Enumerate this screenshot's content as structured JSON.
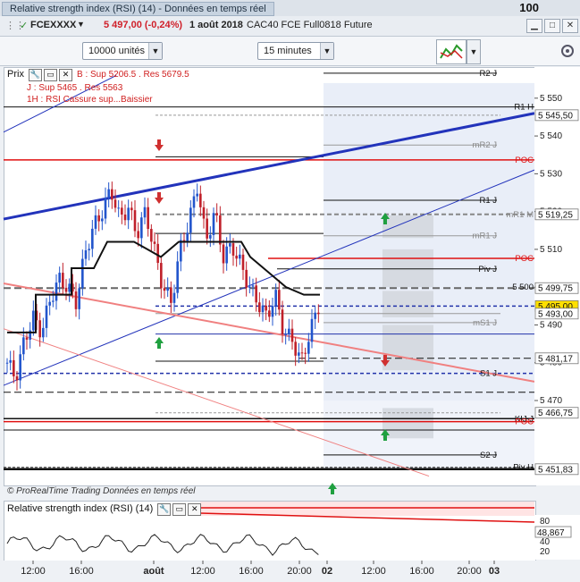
{
  "top_strip": {
    "tab": "Relative strength index (RSI) (14) - Données en temps réel",
    "value": "100"
  },
  "title": {
    "instrument": "FCEXXXX",
    "price_change": "5 497,00 (-0,24%)",
    "date": "1 août 2018",
    "description": "CAC40 FCE Full0818 Future"
  },
  "toolbar": {
    "quantity": "10000 unités",
    "timeframe": "15 minutes"
  },
  "price_panel": {
    "name": "Prix",
    "annotations": [
      "B : Sup 5206.5 . Res 5679.5",
      "J : Sup 5465 . Res 5563",
      "1H : RSI Cassure sup...Baissier"
    ],
    "footer": "© ProRealTime Trading  Données en temps réel"
  },
  "rsi_panel": {
    "name": "Relative strength index (RSI) (14)",
    "value": "48,867"
  },
  "x_axis": [
    "12:00",
    "16:00",
    "août",
    "12:00",
    "16:00",
    "20:00",
    "02",
    "12:00",
    "16:00",
    "20:00",
    "03"
  ],
  "colors": {
    "up": "#2255cc",
    "down": "#c0202a",
    "blue_trend": "#2233bb",
    "poc": "#e01010",
    "pink_trend": "#f08080"
  },
  "chart_data": {
    "type": "candlestick",
    "title": "FCEXXXX 15 minutes",
    "ylim": [
      5448,
      5558
    ],
    "y_ticks": [
      5470,
      5480,
      5490,
      5500,
      5510,
      5520,
      5530,
      5540,
      5550
    ],
    "price_labels": [
      {
        "label": "R2 J",
        "value": 5556.6
      },
      {
        "label": "R1 H",
        "value": 5547.67
      },
      {
        "label": "",
        "value": 5545.5
      },
      {
        "label": "mR2 J",
        "value": 5537.6
      },
      {
        "label": "POC",
        "value": 5533.67
      },
      {
        "label": "R1 J",
        "value": 5523.0
      },
      {
        "label": "mR1 M",
        "value": 5519.25
      },
      {
        "label": "",
        "value": 5519.25
      },
      {
        "label": "mR1 J",
        "value": 5513.6
      },
      {
        "label": "POC",
        "value": 5507.6
      },
      {
        "label": "Piv J",
        "value": 5504.83
      },
      {
        "label": "5 500",
        "value": 5500.0
      },
      {
        "label": "",
        "value": 5499.75
      },
      {
        "label": "",
        "value": 5495.0
      },
      {
        "label": "",
        "value": 5493.0
      },
      {
        "label": "mS1 J",
        "value": 5490.6
      },
      {
        "label": "",
        "value": 5481.17
      },
      {
        "label": "S1 J",
        "value": 5477.2
      },
      {
        "label": "",
        "value": 5466.75
      },
      {
        "label": "KIJ J",
        "value": 5465.2
      },
      {
        "label": "POC",
        "value": 5464.4
      },
      {
        "label": "S2 J",
        "value": 5455.6
      },
      {
        "label": "Piv H",
        "value": 5452.33
      },
      {
        "label": "",
        "value": 5451.83
      }
    ],
    "last_price": 5495.0,
    "rsi": {
      "levels": [
        20,
        40,
        60,
        80
      ],
      "last": 48.867
    }
  }
}
